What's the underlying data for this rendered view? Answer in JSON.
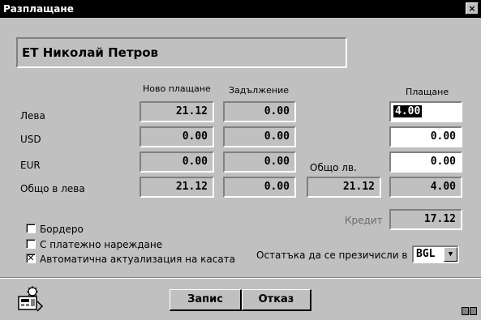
{
  "window": {
    "title": "Разплащане",
    "close_label": "×"
  },
  "company": "ЕТ Николай Петров",
  "columns": {
    "new_payment": "Ново плащане",
    "debt": "Задължение",
    "payment": "Плащане"
  },
  "rows": [
    {
      "label": "Лева",
      "new_payment": "21.12",
      "debt": "0.00",
      "payment": "4.00"
    },
    {
      "label": "USD",
      "new_payment": "0.00",
      "debt": "0.00",
      "payment": "0.00"
    },
    {
      "label": "EUR",
      "new_payment": "0.00",
      "debt": "0.00",
      "payment": "0.00"
    },
    {
      "label": "Общо в лева",
      "new_payment": "21.12",
      "debt": "0.00",
      "payment": "4.00"
    }
  ],
  "total_bgn": {
    "label": "Общо лв.",
    "value": "21.12"
  },
  "credit": {
    "label": "Кредит",
    "value": "17.12"
  },
  "checkboxes": [
    {
      "label": "Бордеро",
      "checked": false
    },
    {
      "label": "С платежно нареждане",
      "checked": false
    },
    {
      "label": "Автоматична актуализация на касата",
      "checked": true
    }
  ],
  "remainder": {
    "label": "Остатъка да се презичисли в",
    "currency": "BGL"
  },
  "buttons": {
    "save": "Запис",
    "cancel": "Отказ"
  },
  "icons": {
    "check_mark": "✕",
    "dropdown_arrow": "▼"
  }
}
